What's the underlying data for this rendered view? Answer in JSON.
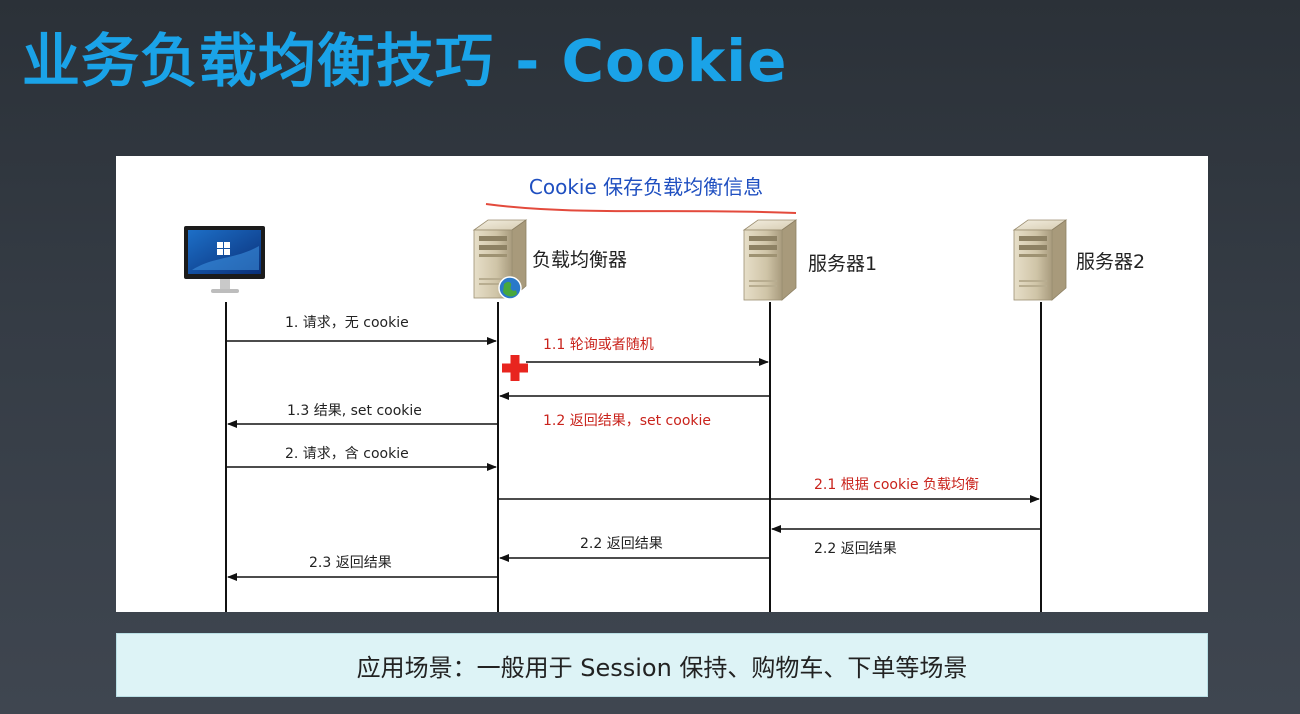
{
  "slide": {
    "title": "业务负载均衡技巧 - Cookie",
    "banner": "应用场景：一般用于 Session 保持、购物车、下单等场景"
  },
  "diagram": {
    "subtitle": "Cookie 保存负载均衡信息",
    "entities": [
      {
        "id": "client",
        "label": "",
        "icon": "monitor-icon"
      },
      {
        "id": "lb",
        "label": "负载均衡器",
        "icon": "server-globe-icon"
      },
      {
        "id": "server1",
        "label": "服务器1",
        "icon": "server-icon"
      },
      {
        "id": "server2",
        "label": "服务器2",
        "icon": "server-icon"
      }
    ],
    "messages": [
      {
        "label": "1. 请求，无 cookie",
        "from": "client",
        "to": "lb",
        "color": "black"
      },
      {
        "label": "1.1 轮询或者随机",
        "from": "lb",
        "to": "server1",
        "color": "red"
      },
      {
        "label": "1.2 返回结果，set cookie",
        "from": "server1",
        "to": "lb",
        "color": "red"
      },
      {
        "label": "1.3 结果, set cookie",
        "from": "lb",
        "to": "client",
        "color": "black"
      },
      {
        "label": "2. 请求，含 cookie",
        "from": "client",
        "to": "lb",
        "color": "black"
      },
      {
        "label": "2.1 根据 cookie 负载均衡",
        "from": "lb",
        "to": "server2",
        "color": "red"
      },
      {
        "label": "2.2 返回结果",
        "from": "server2",
        "to": "server1",
        "color": "black"
      },
      {
        "label": "2.2 返回结果",
        "from": "server1",
        "to": "lb",
        "color": "black"
      },
      {
        "label": "2.3 返回结果",
        "from": "lb",
        "to": "client",
        "color": "black"
      }
    ],
    "colors": {
      "accent": "#1aa3e8",
      "red": "#c9231c",
      "marker": "#e8251f"
    }
  }
}
